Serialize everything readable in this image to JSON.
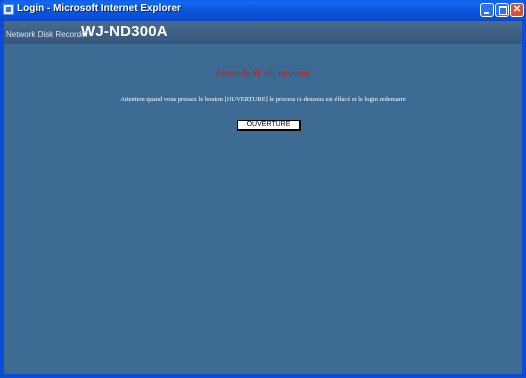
{
  "window": {
    "title": "Login - Microsoft Internet Explorer",
    "app_icon": "ie-page-icon",
    "controls": [
      "minimize-icon",
      "maximize-icon",
      "close-icon"
    ]
  },
  "header": {
    "product_line": "Network Disk Recorder",
    "model": "WJ-ND300A"
  },
  "main": {
    "error_title": "Erreur de SE est survenue",
    "message": "Attention quand vous pressez le bouton [OUVERTURE] le process ci-dessous est éffacé et le login redemarre",
    "open_button_label": "OUVERTURE"
  },
  "colors": {
    "titlebar": "#0a4cd8",
    "header": "#3e5f83",
    "content_background": "#3d6b94",
    "error_text": "#e01010"
  }
}
